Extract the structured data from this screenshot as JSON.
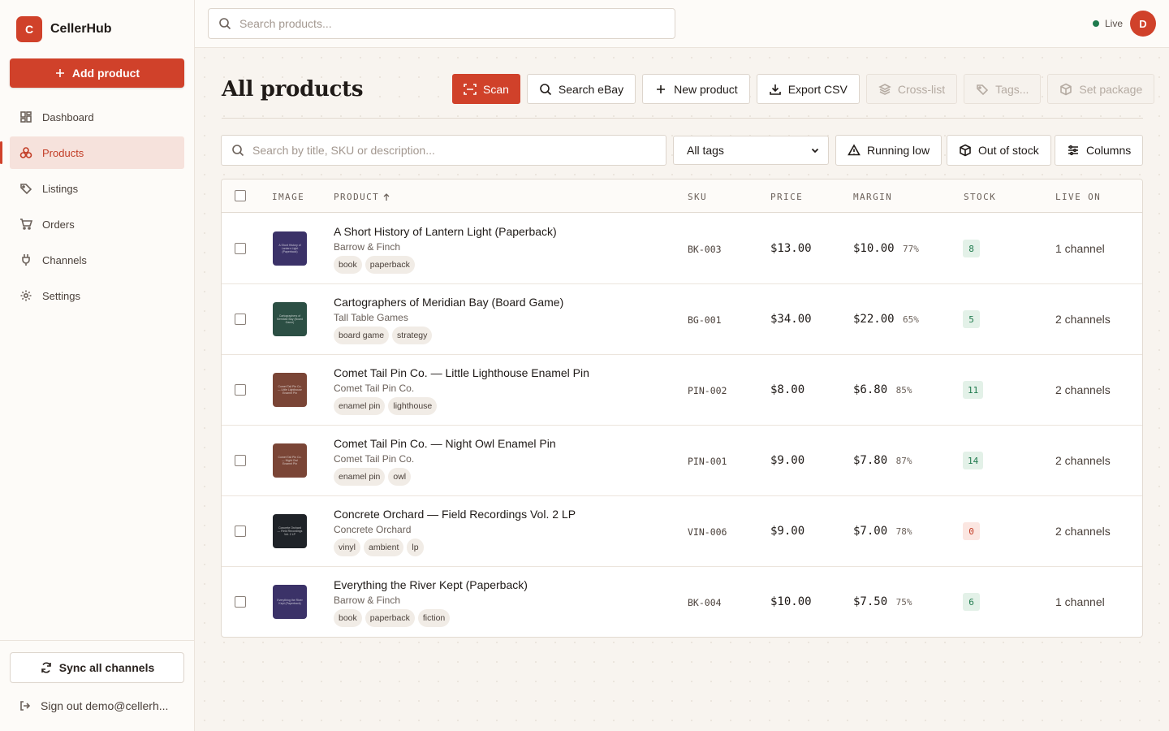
{
  "app": {
    "logo_letter": "C",
    "name": "CellerHub"
  },
  "sidebar": {
    "add_label": "Add product",
    "items": [
      {
        "label": "Dashboard",
        "icon": "dashboard-icon"
      },
      {
        "label": "Products",
        "icon": "products-icon",
        "active": true
      },
      {
        "label": "Listings",
        "icon": "tag-icon"
      },
      {
        "label": "Orders",
        "icon": "cart-icon"
      },
      {
        "label": "Channels",
        "icon": "plug-icon"
      },
      {
        "label": "Settings",
        "icon": "gear-icon"
      }
    ],
    "sync_label": "Sync all channels",
    "signout_label": "Sign out demo@cellerh..."
  },
  "topbar": {
    "search_placeholder": "Search products...",
    "status": "Live",
    "avatar_letter": "D"
  },
  "page": {
    "title": "All products",
    "toolbar": {
      "scan": "Scan",
      "search_ebay": "Search eBay",
      "new_product": "New product",
      "export_csv": "Export CSV",
      "cross_list": "Cross-list",
      "tags": "Tags...",
      "set_package": "Set package"
    },
    "filters": {
      "search_placeholder": "Search by title, SKU or description...",
      "tag_select": "All tags",
      "running_low": "Running low",
      "out_of_stock": "Out of stock",
      "columns": "Columns"
    }
  },
  "table": {
    "headers": {
      "image": "IMAGE",
      "product": "PRODUCT",
      "sku": "SKU",
      "price": "PRICE",
      "margin": "MARGIN",
      "stock": "STOCK",
      "live_on": "LIVE ON"
    },
    "rows": [
      {
        "title": "A Short History of Lantern Light (Paperback)",
        "vendor": "Barrow & Finch",
        "tags": [
          "book",
          "paperback"
        ],
        "thumb_color": "#3b3268",
        "thumb_text": "A Short History of Lantern Light (Paperback)",
        "sku": "BK-003",
        "price": "$13.00",
        "margin": "$10.00",
        "margin_pct": "77%",
        "stock": "8",
        "stock_status": "ok",
        "live_on": "1 channel"
      },
      {
        "title": "Cartographers of Meridian Bay (Board Game)",
        "vendor": "Tall Table Games",
        "tags": [
          "board game",
          "strategy"
        ],
        "thumb_color": "#2c4f44",
        "thumb_text": "Cartographers of Meridian Bay (Board Game)",
        "sku": "BG-001",
        "price": "$34.00",
        "margin": "$22.00",
        "margin_pct": "65%",
        "stock": "5",
        "stock_status": "ok",
        "live_on": "2 channels"
      },
      {
        "title": "Comet Tail Pin Co. — Little Lighthouse Enamel Pin",
        "vendor": "Comet Tail Pin Co.",
        "tags": [
          "enamel pin",
          "lighthouse"
        ],
        "thumb_color": "#7a4536",
        "thumb_text": "Comet Tail Pin Co. — Little Lighthouse Enamel Pin",
        "sku": "PIN-002",
        "price": "$8.00",
        "margin": "$6.80",
        "margin_pct": "85%",
        "stock": "11",
        "stock_status": "ok",
        "live_on": "2 channels"
      },
      {
        "title": "Comet Tail Pin Co. — Night Owl Enamel Pin",
        "vendor": "Comet Tail Pin Co.",
        "tags": [
          "enamel pin",
          "owl"
        ],
        "thumb_color": "#7a4536",
        "thumb_text": "Comet Tail Pin Co. — Night Owl Enamel Pin",
        "sku": "PIN-001",
        "price": "$9.00",
        "margin": "$7.80",
        "margin_pct": "87%",
        "stock": "14",
        "stock_status": "ok",
        "live_on": "2 channels"
      },
      {
        "title": "Concrete Orchard — Field Recordings Vol. 2 LP",
        "vendor": "Concrete Orchard",
        "tags": [
          "vinyl",
          "ambient",
          "lp"
        ],
        "thumb_color": "#1f2328",
        "thumb_text": "Concrete Orchard — Field Recordings Vol. 2 LP",
        "sku": "VIN-006",
        "price": "$9.00",
        "margin": "$7.00",
        "margin_pct": "78%",
        "stock": "0",
        "stock_status": "out",
        "live_on": "2 channels"
      },
      {
        "title": "Everything the River Kept (Paperback)",
        "vendor": "Barrow & Finch",
        "tags": [
          "book",
          "paperback",
          "fiction"
        ],
        "thumb_color": "#3b3268",
        "thumb_text": "Everything the River Kept (Paperback)",
        "sku": "BK-004",
        "price": "$10.00",
        "margin": "$7.50",
        "margin_pct": "75%",
        "stock": "6",
        "stock_status": "ok",
        "live_on": "1 channel"
      }
    ]
  },
  "colors": {
    "accent": "#d0412a",
    "live": "#1f7a4d",
    "stock_ok": "#1f7a4d",
    "stock_out": "#c23c25"
  }
}
